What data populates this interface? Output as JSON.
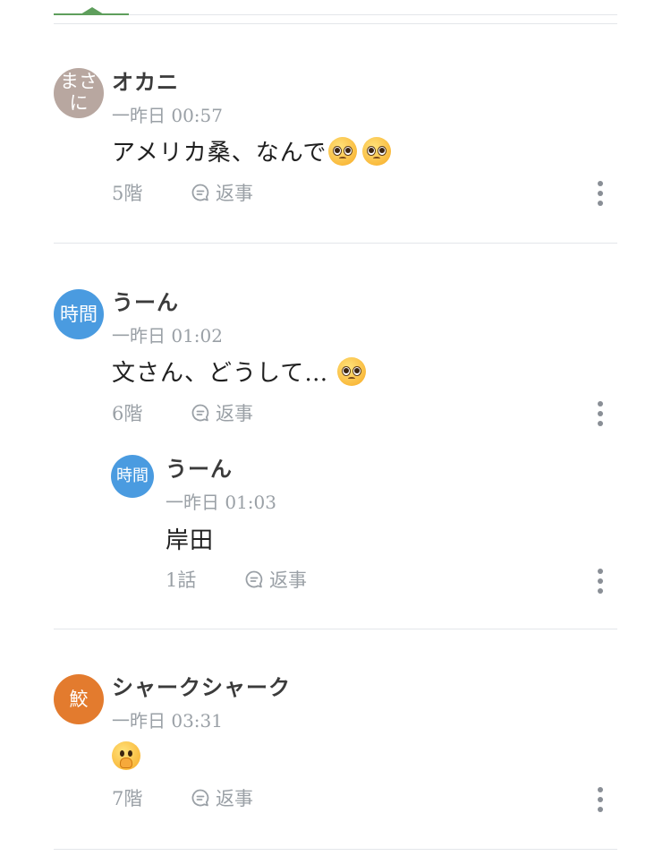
{
  "colors": {
    "accent_green": "#5e9e5c",
    "avatar_taupe": "#b8a7a0",
    "avatar_blue": "#4a9be0",
    "avatar_orange": "#e37b2e",
    "muted_text": "#9aa0a6"
  },
  "comments": [
    {
      "avatar_text": "まさに",
      "avatar_lines": [
        "まさ",
        "に"
      ],
      "name": "オカニ",
      "time": "一昨日 00:57",
      "text": "アメリカ桑、なんで",
      "emoji": [
        "pleading-face-icon",
        "pleading-face-icon"
      ],
      "floor": "5階",
      "reply_label": "返事"
    },
    {
      "avatar_text": "時間",
      "name": "うーん",
      "time": "一昨日 01:02",
      "text": "文さん、どうして…",
      "emoji": [
        "pleading-face-icon"
      ],
      "floor": "6階",
      "reply_label": "返事",
      "replies": [
        {
          "avatar_text": "時間",
          "name": "うーん",
          "time": "一昨日 01:03",
          "text": "岸田",
          "floor": "1話",
          "reply_label": "返事"
        }
      ]
    },
    {
      "avatar_text": "鮫",
      "name": "シャークシャーク",
      "time": "一昨日 03:31",
      "text": "",
      "emoji": [
        "face-with-hand-over-mouth-icon"
      ],
      "floor": "7階",
      "reply_label": "返事"
    }
  ]
}
